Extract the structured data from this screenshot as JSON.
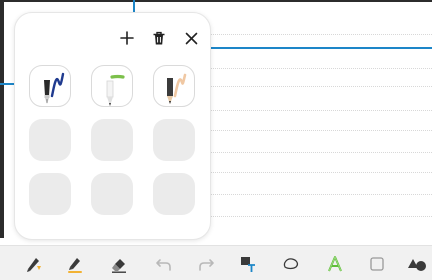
{
  "panel": {
    "actions": [
      {
        "name": "add-pen-icon",
        "label": "+"
      },
      {
        "name": "delete-icon",
        "label": "trash"
      },
      {
        "name": "close-icon",
        "label": "×"
      }
    ],
    "pens": [
      {
        "type": "fountain-pen",
        "ink": "#1f3a8f"
      },
      {
        "type": "marker",
        "ink": "#7cc04b"
      },
      {
        "type": "pencil",
        "ink": "#f0c8a3"
      }
    ],
    "empty_slots": 6
  },
  "toolbar": {
    "tools": [
      {
        "name": "pen-icon"
      },
      {
        "name": "highlighter-icon"
      },
      {
        "name": "eraser-icon"
      },
      {
        "name": "undo-icon"
      },
      {
        "name": "redo-icon"
      },
      {
        "name": "text-icon"
      },
      {
        "name": "lasso-icon"
      },
      {
        "name": "handwriting-style-icon"
      },
      {
        "name": "shape-icon"
      },
      {
        "name": "color-shapes-icon"
      }
    ]
  },
  "colors": {
    "callout": "#1d86c8",
    "panel_bg": "#ffffff",
    "slot_empty": "#ebebeb",
    "toolbar_bg": "#f1f1f1",
    "accent_orange": "#f2b233",
    "accent_green": "#5fbf3a"
  }
}
